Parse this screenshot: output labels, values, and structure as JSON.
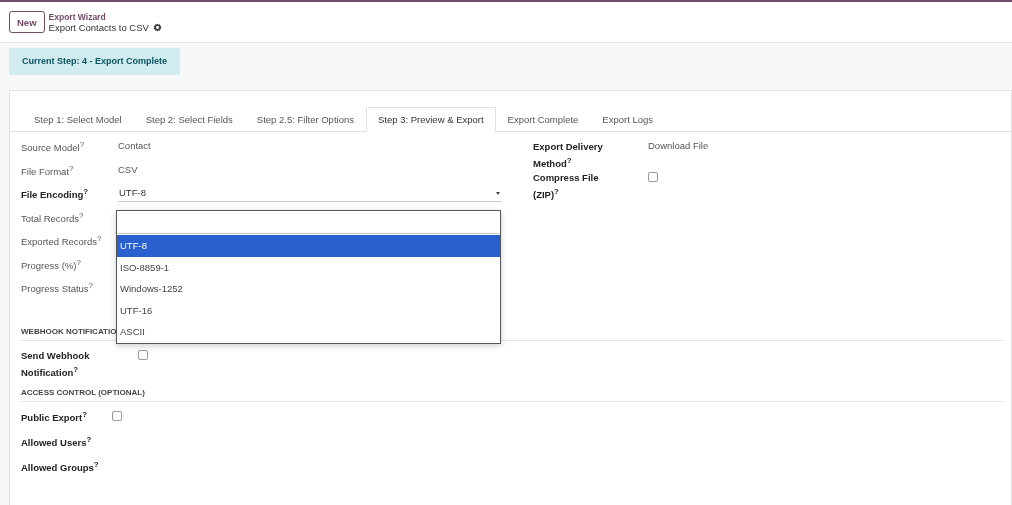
{
  "header": {
    "new_button": "New",
    "breadcrumb": "Export Wizard",
    "record_title": "Export Contacts to CSV"
  },
  "step_badge": "Current Step: 4 - Export Complete",
  "tabs": [
    {
      "label": "Step 1: Select Model",
      "selected": false
    },
    {
      "label": "Step 2: Select Fields",
      "selected": false
    },
    {
      "label": "Step 2.5: Filter Options",
      "selected": false
    },
    {
      "label": "Step 3: Preview & Export",
      "selected": true
    },
    {
      "label": "Export Complete",
      "selected": false
    },
    {
      "label": "Export Logs",
      "selected": false
    }
  ],
  "left_fields": [
    {
      "label": "Source Model$^{?}$",
      "bold": false,
      "kind": "text",
      "value": "Contact"
    },
    {
      "label": "File Format$^{?}$",
      "bold": false,
      "kind": "text",
      "value": "CSV"
    },
    {
      "label": "File Encoding$^{?}$",
      "bold": true,
      "kind": "select",
      "value": "UTF-8"
    },
    {
      "label": "Total Records$^{?}$",
      "bold": false,
      "kind": "empty"
    },
    {
      "label": "Exported Records$^{?}$",
      "bold": false,
      "kind": "empty"
    },
    {
      "label": "Progress (%)$^{?}$",
      "bold": false,
      "kind": "empty"
    },
    {
      "label": "Progress Status$^{?}$",
      "bold": false,
      "kind": "empty"
    }
  ],
  "right_fields": [
    {
      "label": "Export Delivery Method$^{?}$",
      "bold": true,
      "kind": "text",
      "value": "Download File"
    },
    {
      "label": "Compress File (ZIP)$^{?}$",
      "bold": true,
      "kind": "checkbox",
      "checked": false
    }
  ],
  "dropdown": {
    "options": [
      {
        "label": "UTF-8",
        "selected": true
      },
      {
        "label": "ISO-8859-1",
        "selected": false
      },
      {
        "label": "Windows-1252",
        "selected": false
      },
      {
        "label": "UTF-16",
        "selected": false
      },
      {
        "label": "ASCII",
        "selected": false
      }
    ]
  },
  "sections": [
    {
      "title": "WEBHOOK NOTIFICATIO",
      "fields": [
        {
          "label": "Send Webhook Notification$^{?}$",
          "bold": true,
          "kind": "checkbox",
          "checked": false
        }
      ]
    },
    {
      "title": "ACCESS CONTROL (OPTIONAL)",
      "fields": [
        {
          "label": "Public Export$^{?}$",
          "bold": true,
          "kind": "checkbox",
          "checked": false
        },
        {
          "label": "Allowed Users$^{?}$",
          "bold": true,
          "kind": "empty"
        },
        {
          "label": "Allowed Groups$^{?}$",
          "bold": true,
          "kind": "empty"
        }
      ]
    }
  ]
}
